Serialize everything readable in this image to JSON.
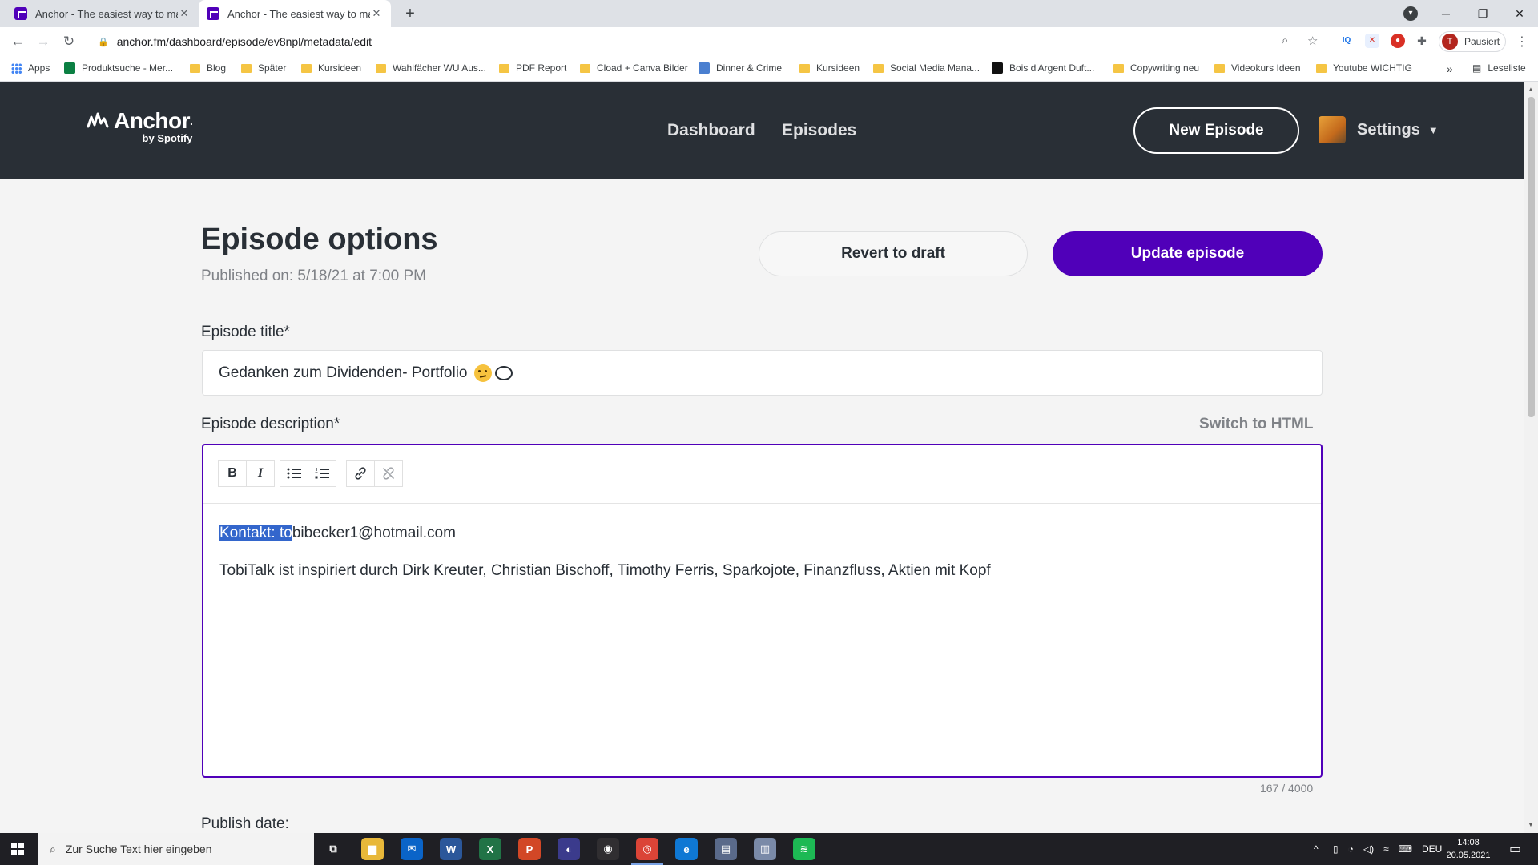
{
  "browser": {
    "tabs": [
      {
        "title": "Anchor - The easiest way to mak",
        "close": "✕"
      },
      {
        "title": "Anchor - The easiest way to mak",
        "close": "✕"
      }
    ],
    "new_tab": "+",
    "window_controls": {
      "minimize": "─",
      "maximize": "❐",
      "close": "✕"
    },
    "nav": {
      "back": "←",
      "forward": "→",
      "reload": "↻"
    },
    "url": "anchor.fm/dashboard/episode/ev8npl/metadata/edit",
    "extensions": {
      "iq": "IQ",
      "profile_initial": "T",
      "profile_label": "Pausiert"
    },
    "bookmarks": [
      {
        "label": "Apps",
        "kind": "apps"
      },
      {
        "label": "Produktsuche - Mer...",
        "kind": "site"
      },
      {
        "label": "Blog",
        "kind": "folder"
      },
      {
        "label": "Später",
        "kind": "folder"
      },
      {
        "label": "Kursideen",
        "kind": "folder"
      },
      {
        "label": "Wahlfächer WU Aus...",
        "kind": "folder"
      },
      {
        "label": "PDF Report",
        "kind": "folder"
      },
      {
        "label": "Cload + Canva Bilder",
        "kind": "folder"
      },
      {
        "label": "Dinner & Crime",
        "kind": "site"
      },
      {
        "label": "Kursideen",
        "kind": "folder"
      },
      {
        "label": "Social Media Mana...",
        "kind": "folder"
      },
      {
        "label": "Bois d'Argent Duft...",
        "kind": "site"
      },
      {
        "label": "Copywriting neu",
        "kind": "folder"
      },
      {
        "label": "Videokurs Ideen",
        "kind": "folder"
      },
      {
        "label": "Youtube WICHTIG",
        "kind": "folder"
      }
    ],
    "bookmarks_more": "»",
    "reading_list": "Leseliste"
  },
  "header": {
    "logo": "Anchor",
    "logo_sub": "by Spotify",
    "nav": [
      "Dashboard",
      "Episodes"
    ],
    "new_episode": "New Episode",
    "settings": "Settings",
    "caret": "▼"
  },
  "page": {
    "title": "Episode options",
    "published": "Published on: 5/18/21 at 7:00 PM",
    "revert_label": "Revert to draft",
    "update_label": "Update episode",
    "episode_title_label": "Episode title*",
    "episode_title_value": "Gedanken zum Dividenden- Portfolio",
    "description_label": "Episode description*",
    "switch_html": "Switch to HTML",
    "toolbar": {
      "bold": "B",
      "italic": "I",
      "bullet_list": "☰",
      "numbered_list": "≡",
      "link": "🔗",
      "unlink": "⛓"
    },
    "description": {
      "line1_selected": "Kontakt: to",
      "line1_rest": "bibecker1@hotmail.com",
      "line2": "TobiTalk ist inspiriert durch Dirk Kreuter, Christian Bischoff, Timothy Ferris, Sparkojote, Finanzfluss, Aktien mit Kopf"
    },
    "char_count": "167 / 4000",
    "publish_date_label": "Publish date:"
  },
  "taskbar": {
    "search_placeholder": "Zur Suche Text hier eingeben",
    "apps": [
      {
        "name": "task-view",
        "glyph": "⧉",
        "color": "transparent"
      },
      {
        "name": "file-explorer",
        "glyph": "▆",
        "color": "#e8b83a"
      },
      {
        "name": "mail",
        "glyph": "✉",
        "color": "#0a64c8"
      },
      {
        "name": "word",
        "glyph": "W",
        "color": "#2b579a"
      },
      {
        "name": "excel",
        "glyph": "X",
        "color": "#217346"
      },
      {
        "name": "powerpoint",
        "glyph": "P",
        "color": "#d24726"
      },
      {
        "name": "app-orange",
        "glyph": "◐",
        "color": "#3b3b8c"
      },
      {
        "name": "obs",
        "glyph": "◉",
        "color": "#302e31"
      },
      {
        "name": "chrome",
        "glyph": "◎",
        "color": "#db4437"
      },
      {
        "name": "edge",
        "glyph": "e",
        "color": "#0f78d4"
      },
      {
        "name": "app-blue",
        "glyph": "▤",
        "color": "#5a6a8a"
      },
      {
        "name": "app-doc",
        "glyph": "▥",
        "color": "#7a8aa8"
      },
      {
        "name": "spotify",
        "glyph": "≋",
        "color": "#1db954"
      }
    ],
    "tray": {
      "language": "DEU",
      "time": "14:08",
      "date": "20.05.2021",
      "up": "^",
      "notification": "▭"
    }
  },
  "colors": {
    "brand_purple": "#5000b9",
    "header_dark": "#292f36",
    "selection": "#3366cc"
  }
}
